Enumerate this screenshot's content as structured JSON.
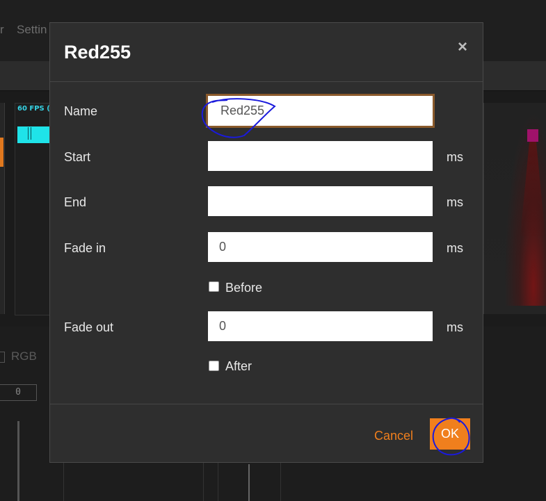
{
  "background": {
    "menu_fragment_1": "r",
    "menu_fragment_2": "Settin",
    "fps_text": "60 FPS (",
    "rgb_label": "RGB",
    "number_value": "0"
  },
  "dialog": {
    "title": "Red255",
    "close_icon": "close-icon",
    "fields": {
      "name": {
        "label": "Name",
        "value": "Red255"
      },
      "start": {
        "label": "Start",
        "value": "",
        "unit": "ms"
      },
      "end": {
        "label": "End",
        "value": "",
        "unit": "ms"
      },
      "fade_in": {
        "label": "Fade in",
        "value": "0",
        "unit": "ms"
      },
      "before": {
        "label": "Before",
        "checked": false
      },
      "fade_out": {
        "label": "Fade out",
        "value": "0",
        "unit": "ms"
      },
      "after": {
        "label": "After",
        "checked": false
      }
    },
    "buttons": {
      "cancel": "Cancel",
      "ok": "OK"
    }
  },
  "colors": {
    "accent": "#f07f1d",
    "annotation": "#1a1adc",
    "dialog_bg": "#2e2e2e"
  }
}
